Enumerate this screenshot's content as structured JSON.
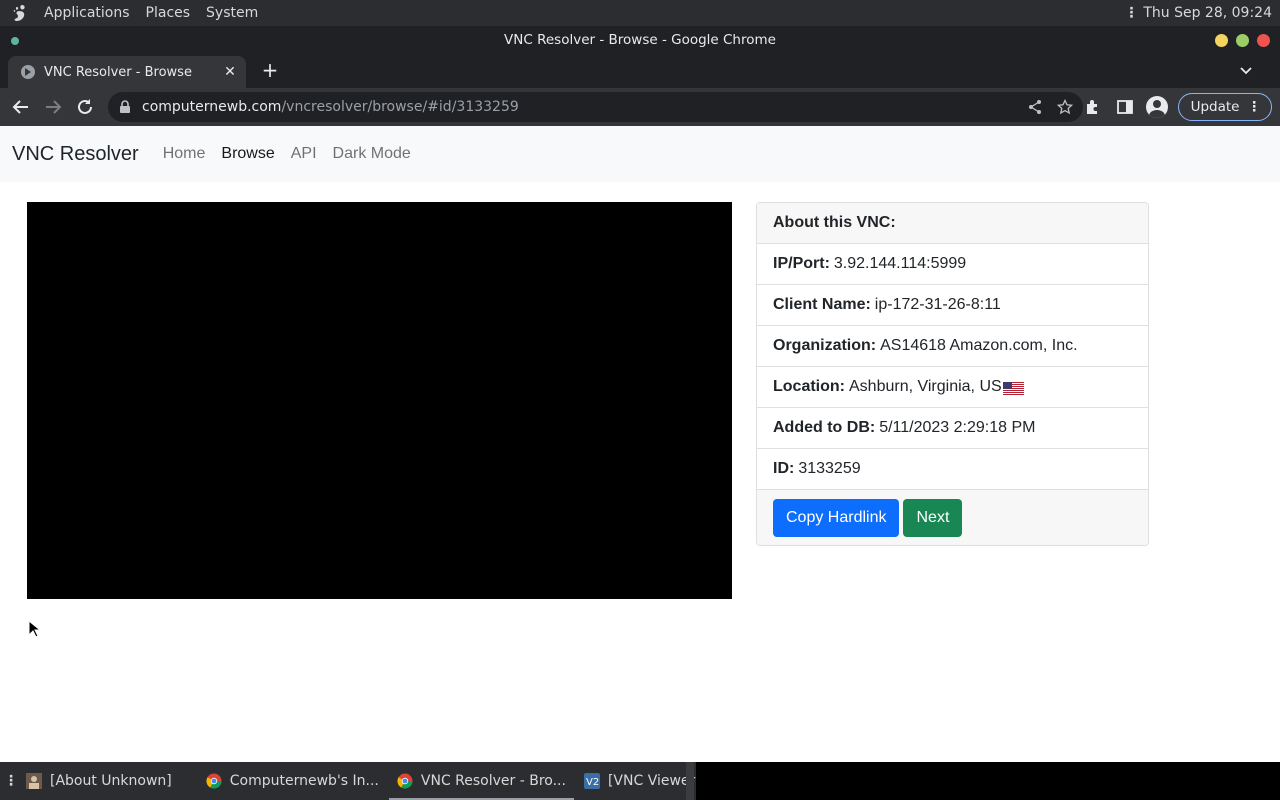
{
  "top_panel": {
    "menus": [
      "Applications",
      "Places",
      "System"
    ],
    "clock": "Thu Sep 28, 09:24"
  },
  "window": {
    "title": "VNC Resolver - Browse - Google Chrome"
  },
  "tabs": [
    {
      "title": "VNC Resolver - Browse",
      "close": "✕"
    }
  ],
  "toolbar": {
    "url_host": "computernewb.com",
    "url_path": "/vncresolver/browse/#id/3133259",
    "update_label": "Update"
  },
  "navbar": {
    "brand": "VNC Resolver",
    "links": [
      "Home",
      "Browse",
      "API",
      "Dark Mode"
    ],
    "active": "Browse"
  },
  "vnc_card": {
    "header": "About this VNC:",
    "rows": [
      {
        "label": "IP/Port:",
        "value": "3.92.144.114:5999"
      },
      {
        "label": "Client Name:",
        "value": "ip-172-31-26-8:11"
      },
      {
        "label": "Organization:",
        "value": "AS14618 Amazon.com, Inc."
      },
      {
        "label": "Location:",
        "value": "Ashburn, Virginia, US"
      },
      {
        "label": "Added to DB:",
        "value": "5/11/2023 2:29:18 PM"
      },
      {
        "label": "ID:",
        "value": "3133259"
      }
    ],
    "copy_button": "Copy Hardlink",
    "next_button": "Next"
  },
  "taskbar": {
    "tasks": [
      {
        "label": "[About Unknown]",
        "icon": "user-icon"
      },
      {
        "label": "Computernewb's In...",
        "icon": "chrome-icon"
      },
      {
        "label": "VNC Resolver - Bro...",
        "icon": "chrome-icon"
      },
      {
        "label": "[VNC Viewer]",
        "icon": "vnc-viewer-icon"
      }
    ]
  },
  "colors": {
    "primary": "#0d6efd",
    "success": "#198754",
    "chrome_dark": "#202124"
  }
}
